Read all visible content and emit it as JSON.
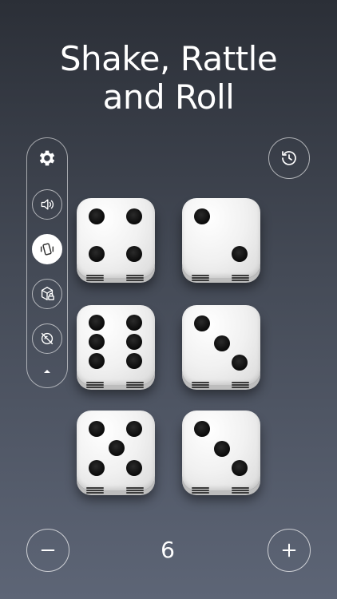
{
  "title": {
    "line1": "Shake, Rattle",
    "line2": "and Roll"
  },
  "sidebar": {
    "items": [
      {
        "icon": "gear-icon"
      },
      {
        "icon": "sound-icon"
      },
      {
        "icon": "shake-phone-icon",
        "active": true
      },
      {
        "icon": "cube-lock-icon"
      },
      {
        "icon": "hide-icon"
      },
      {
        "icon": "chevron-up-icon"
      }
    ]
  },
  "history": {
    "icon": "history-icon"
  },
  "dice": [
    {
      "value": 4
    },
    {
      "value": 2
    },
    {
      "value": 6
    },
    {
      "value": 3
    },
    {
      "value": 5
    },
    {
      "value": 3
    }
  ],
  "controls": {
    "count": "6",
    "minus": "−",
    "plus": "+"
  },
  "colors": {
    "background_top": "#2b2f37",
    "background_bottom": "#5d6576",
    "die": "#f1f1f1",
    "pip": "#0a0a0a"
  }
}
